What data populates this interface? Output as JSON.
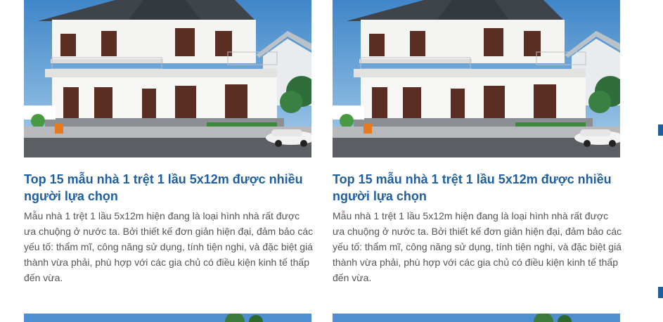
{
  "posts": [
    {
      "title": "Top 15 mẫu nhà 1 trệt 1 lầu 5x12m được nhiều người lựa chọn",
      "excerpt": "Mẫu nhà 1 trệt 1 lầu 5x12m hiện đang là loại hình nhà rất được ưa chuộng ở nước ta. Bởi thiết kế đơn giản hiện đại, đảm bảo các yếu tố: thẩm mĩ, công năng sử dụng, tính tiện nghi, và đặc biệt giá thành vừa phải, phù hợp với các gia chủ có điều kiện kinh tế thấp đến vừa."
    },
    {
      "title": "Top 15 mẫu nhà 1 trệt 1 lầu 5x12m được nhiều người lựa chọn",
      "excerpt": "Mẫu nhà 1 trệt 1 lầu 5x12m hiện đang là loại hình nhà rất được ưa chuộng ở nước ta. Bởi thiết kế đơn giản hiện đại, đảm bảo các yếu tố: thẩm mĩ, công năng sử dụng, tính tiện nghi, và đặc biệt giá thành vừa phải, phù hợp với các gia chủ có điều kiện kinh tế thấp đến vừa."
    }
  ],
  "colors": {
    "title": "#1f5fa0",
    "excerpt": "#555555",
    "accent": "#1f5fa0"
  }
}
